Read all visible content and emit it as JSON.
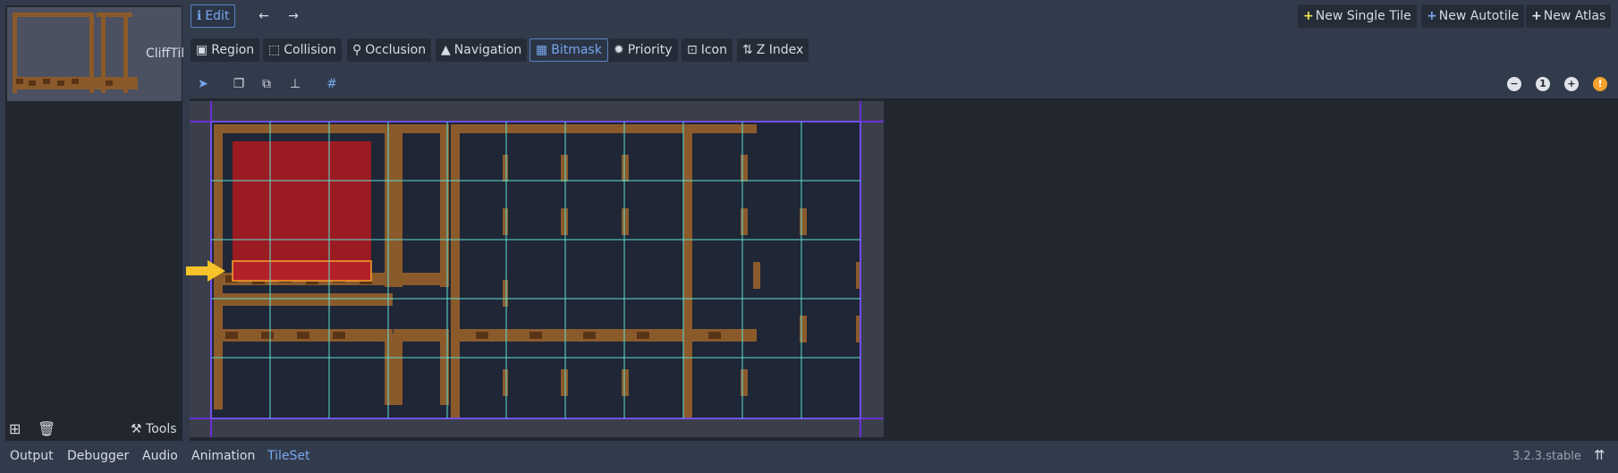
{
  "tile_list": {
    "tile_name": "CliffTil",
    "add_icon": "add-icon",
    "remove_icon": "trash-icon",
    "tools_label": "Tools"
  },
  "toolbar": {
    "edit_label": "Edit",
    "new_single_tile": "New Single Tile",
    "new_autotile": "New Autotile",
    "new_atlas": "New Atlas"
  },
  "modes": [
    {
      "label": "Region",
      "icon": "region-icon"
    },
    {
      "label": "Collision",
      "icon": "collision-icon"
    },
    {
      "label": "Occlusion",
      "icon": "occlusion-icon"
    },
    {
      "label": "Navigation",
      "icon": "navigation-icon"
    },
    {
      "label": "Bitmask",
      "icon": "bitmask-icon",
      "active": true
    },
    {
      "label": "Priority",
      "icon": "priority-icon"
    },
    {
      "label": "Icon",
      "icon": "icon-icon"
    },
    {
      "label": "Z Index",
      "icon": "zindex-icon"
    }
  ],
  "zoom_controls": {
    "reset_label": "1"
  },
  "bottom": {
    "tabs": [
      "Output",
      "Debugger",
      "Audio",
      "Animation",
      "TileSet"
    ],
    "active_tab": "TileSet",
    "version": "3.2.3.stable"
  },
  "colors": {
    "accent": "#77a7ec",
    "plus_yellow": "#f1e94f",
    "bitmask_red": "#9b1b22",
    "grid_cyan": "#5ce0d0",
    "grid_purple": "#6a2fd6",
    "arrow_yellow": "#f7c22a",
    "highlight_orange": "#f5a32d"
  }
}
